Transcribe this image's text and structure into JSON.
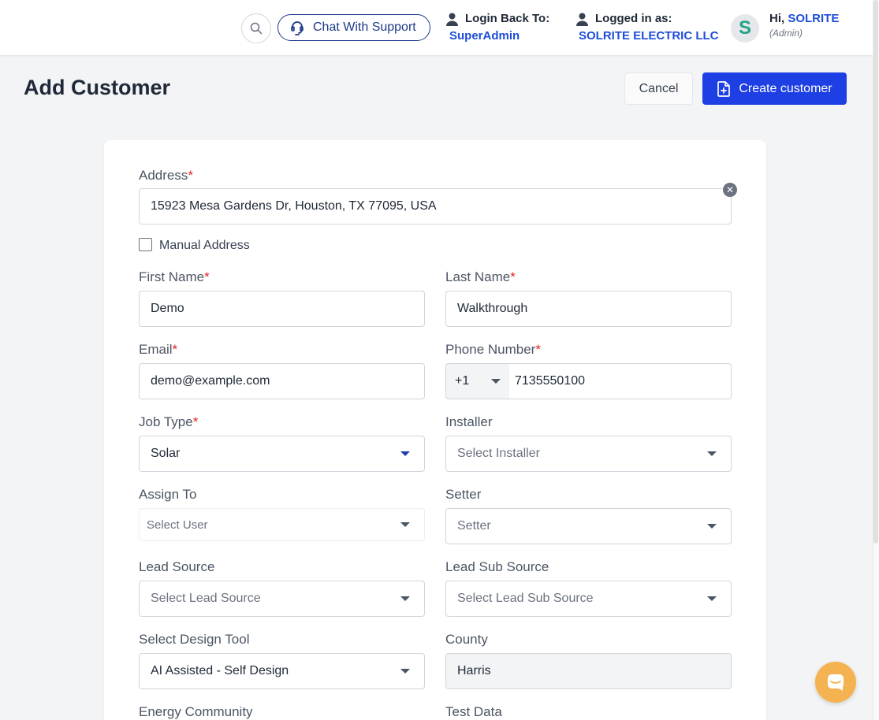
{
  "header": {
    "chat_support": "Chat With Support",
    "login_back_label": "Login Back To:",
    "login_back_link": "SuperAdmin",
    "logged_in_label": "Logged in as:",
    "logged_in_link": "SOLRITE ELECTRIC LLC",
    "avatar_letter": "S",
    "greeting_prefix": "Hi,",
    "greeting_name": "SOLRITE",
    "role": "(Admin)"
  },
  "page": {
    "title": "Add Customer",
    "cancel_label": "Cancel",
    "create_label": "Create customer"
  },
  "form": {
    "address": {
      "label": "Address",
      "required": "*",
      "value": "15923 Mesa Gardens Dr, Houston, TX 77095, USA"
    },
    "manual_address": {
      "label": "Manual Address",
      "checked": false
    },
    "first_name": {
      "label": "First Name",
      "required": "*",
      "value": "Demo"
    },
    "last_name": {
      "label": "Last Name",
      "required": "*",
      "value": "Walkthrough"
    },
    "email": {
      "label": "Email",
      "required": "*",
      "value": "demo@example.com"
    },
    "phone": {
      "label": "Phone Number",
      "required": "*",
      "code": "+1",
      "value": "7135550100"
    },
    "job_type": {
      "label": "Job Type",
      "required": "*",
      "value": "Solar"
    },
    "installer": {
      "label": "Installer",
      "placeholder": "Select Installer"
    },
    "assign_to": {
      "label": "Assign To",
      "placeholder": "Select User"
    },
    "setter": {
      "label": "Setter",
      "placeholder": "Setter"
    },
    "lead_source": {
      "label": "Lead Source",
      "placeholder": "Select Lead Source"
    },
    "lead_sub_source": {
      "label": "Lead Sub Source",
      "placeholder": "Select Lead Sub Source"
    },
    "design_tool": {
      "label": "Select Design Tool",
      "value": "AI Assisted - Self Design"
    },
    "county": {
      "label": "County",
      "value": "Harris"
    },
    "energy_community": {
      "label": "Energy Community"
    },
    "test_data": {
      "label": "Test Data"
    }
  },
  "colors": {
    "primary": "#1d3fe3",
    "link": "#1d4ed8",
    "required": "#dc2626",
    "chat_fab": "#f4b350"
  },
  "icons": [
    "search-icon",
    "support-icon",
    "user-icon",
    "clear-icon",
    "file-plus-icon",
    "chevron-down-icon",
    "chat-bubble-icon"
  ]
}
